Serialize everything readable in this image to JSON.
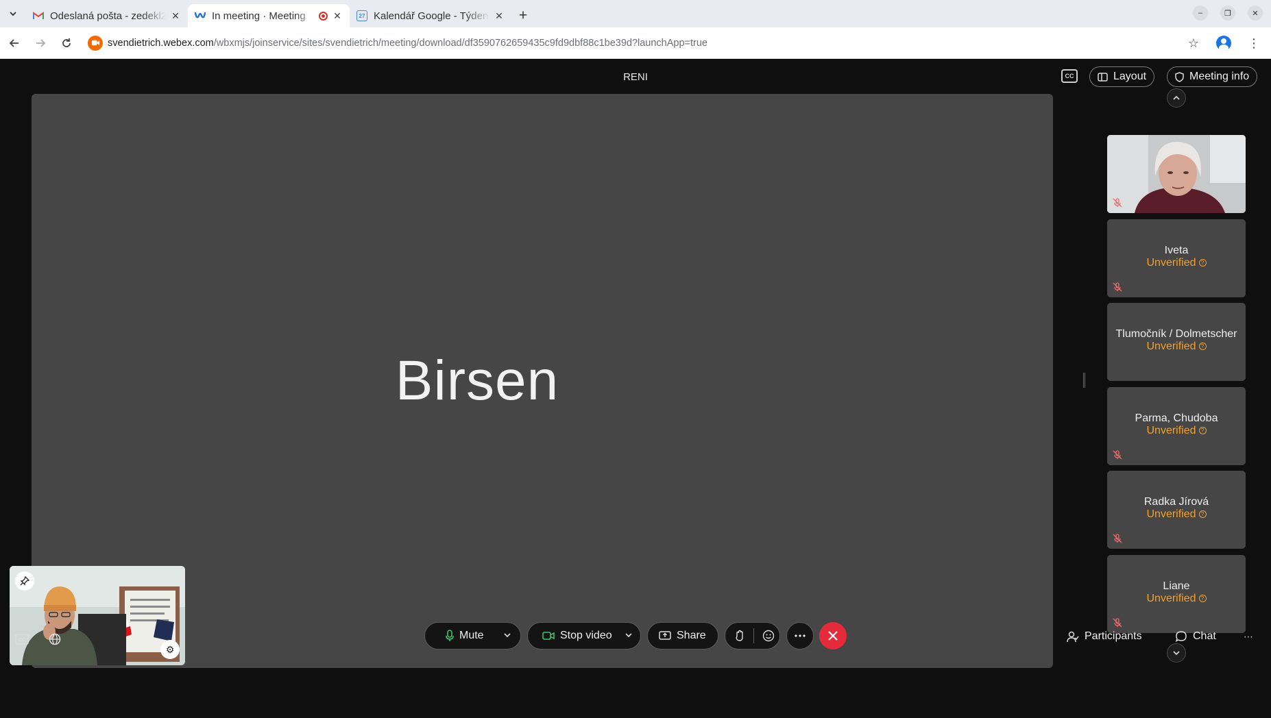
{
  "browser": {
    "tabs": [
      {
        "title": "Odeslaná pošta - zedekl2",
        "active": false,
        "favicon": "gmail-icon"
      },
      {
        "title": "In meeting · Meeting",
        "active": true,
        "favicon": "webex-icon",
        "recording": true
      },
      {
        "title": "Kalendář Google - Týden",
        "active": false,
        "favicon": "google-calendar-icon",
        "favicon_text": "27"
      }
    ],
    "url_host": "svendietrich.webex.com",
    "url_path": "/wbxmjs/joinservice/sites/svendietrich/meeting/download/df3590762659435c9fd9dbf88c1be39d?launchApp=true"
  },
  "meeting": {
    "title": "RENI",
    "layout_label": "Layout",
    "meeting_info_label": "Meeting info",
    "stage_name": "Birsen",
    "participants": [
      {
        "name": "",
        "status": "",
        "video": true,
        "muted": true
      },
      {
        "name": "Iveta",
        "status": "Unverified",
        "muted": true
      },
      {
        "name": "Tlumočník / Dolmetscher",
        "status": "Unverified",
        "muted": false
      },
      {
        "name": "Parma, Chudoba",
        "status": "Unverified",
        "muted": true
      },
      {
        "name": "Radka Jírová",
        "status": "Unverified",
        "muted": true
      },
      {
        "name": "Liane",
        "status": "Unverified",
        "muted": true
      }
    ]
  },
  "controls": {
    "mute_label": "Mute",
    "stop_video_label": "Stop video",
    "share_label": "Share",
    "participants_label": "Participants",
    "chat_label": "Chat"
  },
  "colors": {
    "accent_unverified": "#f4a02a",
    "end_call": "#e52b3a",
    "stage_bg": "#464646",
    "mic_green": "#3ec06a"
  }
}
